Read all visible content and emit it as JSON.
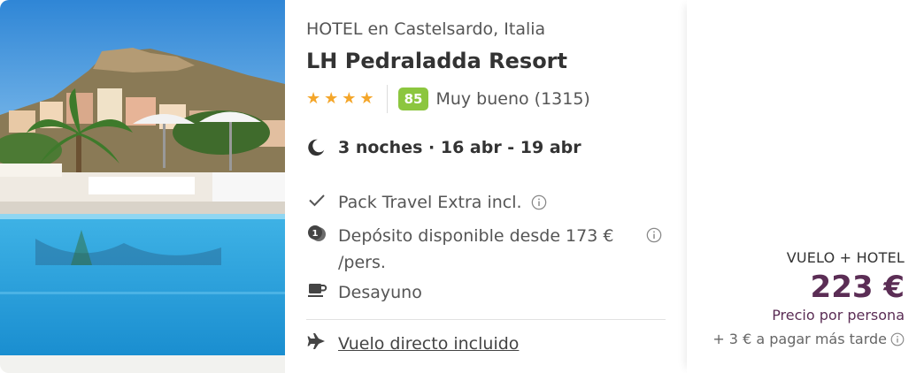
{
  "photo": {
    "alt": "Castelsardo hotel pool and hillside town"
  },
  "hotel": {
    "category": "HOTEL en Castelsardo, Italia",
    "name": "LH Pedraladda Resort",
    "stars": 4,
    "score": "85",
    "score_text": "Muy bueno (1315)"
  },
  "stay": {
    "summary": "3 noches · 16 abr - 19 abr"
  },
  "features": {
    "pack": "Pack Travel Extra incl.",
    "deposit": "Depósito disponible desde 173 € /pers.",
    "board": "Desayuno",
    "flight": "Vuelo directo incluido"
  },
  "price": {
    "combo": "VUELO + HOTEL",
    "amount": "223 €",
    "per_person": "Precio por persona",
    "later": "+ 3 € a pagar más tarde"
  },
  "colors": {
    "price": "#5b2d55",
    "score_bg": "#8cc63f",
    "star": "#f4a62a"
  }
}
